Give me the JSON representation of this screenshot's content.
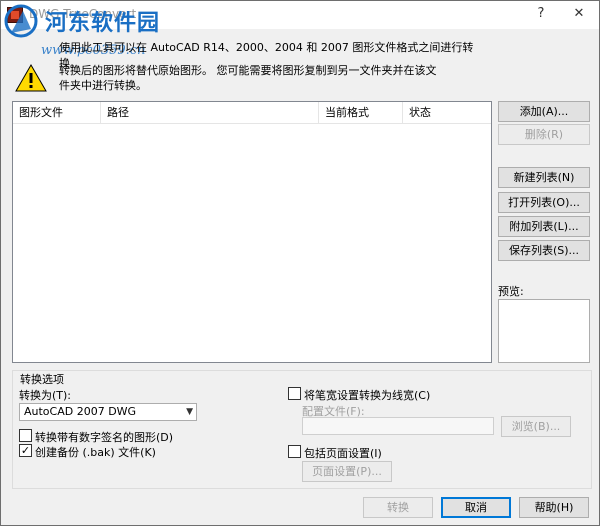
{
  "window": {
    "title": "DWG TrueConvert"
  },
  "watermark": {
    "brand": "河东软件园",
    "url": "www.pc0359.cn"
  },
  "intro_text": "使用此工具可以在 AutoCAD R14、2000、2004 和 2007 图形文件格式之间进行转换。",
  "warning_text": "转换后的图形将替代原始图形。 您可能需要将图形复制到另一文件夹并在该文件夹中进行转换。",
  "file_list": {
    "columns": [
      "图形文件",
      "路径",
      "当前格式",
      "状态"
    ],
    "rows": []
  },
  "side_buttons": {
    "add": "添加(A)...",
    "remove": "删除(R)",
    "new_list": "新建列表(N)",
    "open_list": "打开列表(O)...",
    "append_list": "附加列表(L)...",
    "save_list": "保存列表(S)..."
  },
  "preview_label": "预览:",
  "options": {
    "group_title": "转换选项",
    "convert_to_label": "转换为(T):",
    "convert_to_value": "AutoCAD 2007 DWG",
    "convert_signed_label": "转换带有数字签名的图形(D)",
    "convert_signed_checked": false,
    "backup_label": "创建备份 (.bak) 文件(K)",
    "backup_checked": true,
    "pen_width_label": "将笔宽设置转换为线宽(C)",
    "pen_width_checked": false,
    "config_file_label": "配置文件(F):",
    "config_file_value": "",
    "browse_label": "浏览(B)...",
    "include_page_setup_label": "包括页面设置(I)",
    "include_page_setup_checked": false,
    "page_setup_button": "页面设置(P)..."
  },
  "footer": {
    "convert": "转换",
    "cancel": "取消",
    "help": "帮助(H)"
  },
  "titlebar": {
    "help_glyph": "?",
    "close_glyph": "✕"
  }
}
